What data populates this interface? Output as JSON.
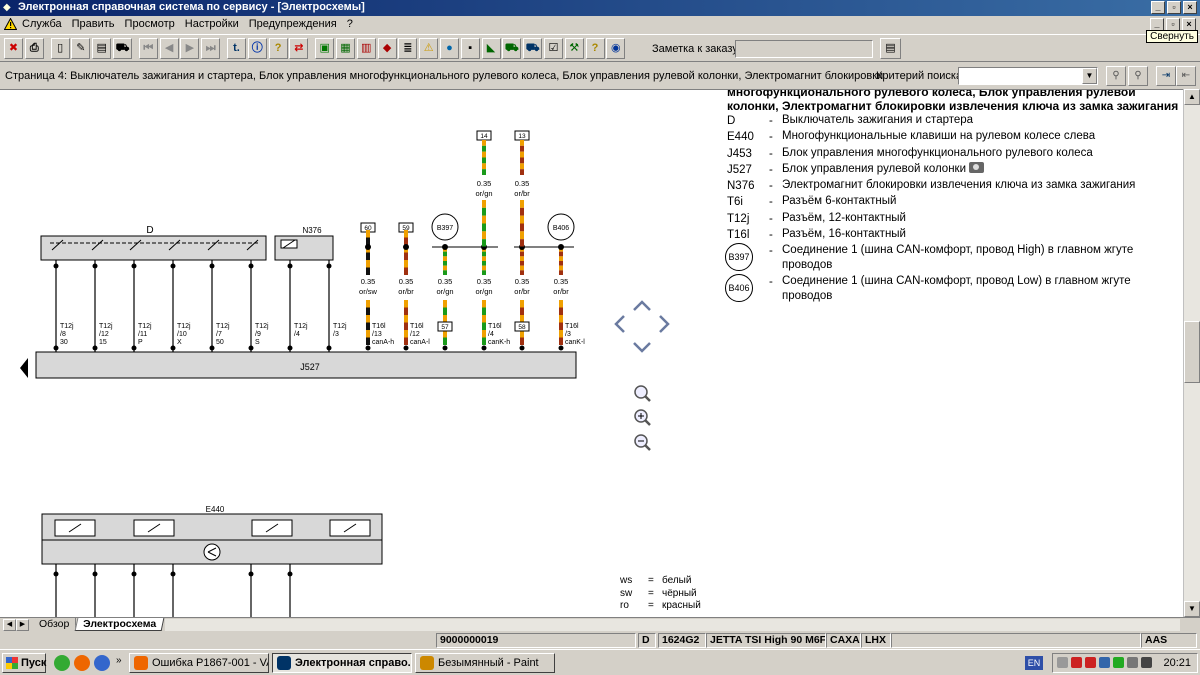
{
  "window": {
    "title": "Электронная справочная система по сервису - [Электросхемы]",
    "tooltip": "Свернуть"
  },
  "menu": {
    "items": [
      "Служба",
      "Править",
      "Просмотр",
      "Настройки",
      "Предупреждения",
      "?"
    ]
  },
  "toolbar": {
    "note_label": "Заметка к заказу:",
    "note_value": ""
  },
  "page": {
    "title": "Страница 4: Выключатель зажигания и стартера, Блок управления многофункционального рулевого колеса, Блок управления рулевой колонки, Электромагнит блокировки",
    "search_label": "Критерий поиска:",
    "search_value": ""
  },
  "diagram": {
    "labels": {
      "d": "D",
      "n376": "N376",
      "j527": "J527",
      "e440": "E440",
      "b397": "B397",
      "b406": "B406"
    },
    "bottom_pins": [
      {
        "conn": "T12j",
        "pin": "/8",
        "term": "30"
      },
      {
        "conn": "T12j",
        "pin": "/12",
        "term": "15"
      },
      {
        "conn": "T12j",
        "pin": "/11",
        "term": "P"
      },
      {
        "conn": "T12j",
        "pin": "/10",
        "term": "X"
      },
      {
        "conn": "T12j",
        "pin": "/7",
        "term": "50"
      },
      {
        "conn": "T12j",
        "pin": "/9",
        "term": "S"
      },
      {
        "conn": "T12j",
        "pin": "/4",
        "term": ""
      },
      {
        "conn": "T12j",
        "pin": "/3",
        "term": ""
      }
    ],
    "top_boxes": [
      "60",
      "59",
      "14",
      "13",
      "57",
      "58"
    ],
    "wires": [
      {
        "size": "0.35",
        "color": "or/sw",
        "conn": "T16l",
        "pin": "/13",
        "sig": "canA-h"
      },
      {
        "size": "0.35",
        "color": "or/br",
        "conn": "T16l",
        "pin": "/12",
        "sig": "canA-l"
      },
      {
        "size": "0.35",
        "color": "or/gn",
        "conn": "",
        "pin": "",
        "sig": ""
      },
      {
        "size": "0.35",
        "color": "or/gn",
        "conn": "T16l",
        "pin": "/4",
        "sig": "canK-h"
      },
      {
        "size": "0.35",
        "color": "or/br",
        "conn": "",
        "pin": "",
        "sig": ""
      },
      {
        "size": "0.35",
        "color": "or/br",
        "conn": "T16l",
        "pin": "/3",
        "sig": "canK-l"
      }
    ],
    "upper_wires": [
      {
        "size": "0.35",
        "color": "or/gn"
      },
      {
        "size": "0.35",
        "color": "or/br"
      }
    ]
  },
  "legend": {
    "heading": "многофункционального рулевого колеса, Блок управления рулевой колонки, Электромагнит блокировки извлечения ключа из замка зажигания",
    "rows": [
      {
        "code": "D",
        "desc": "Выключатель зажигания и стартера"
      },
      {
        "code": "E440",
        "desc": "Многофункциональные клавиши на рулевом колесе слева"
      },
      {
        "code": "J453",
        "desc": "Блок управления многофункционального рулевого колеса"
      },
      {
        "code": "J527",
        "desc": "Блок управления рулевой колонки"
      },
      {
        "code": "N376",
        "desc": "Электромагнит блокировки извлечения ключа из замка зажигания"
      },
      {
        "code": "T6i",
        "desc": "Разъём 6-контактный"
      },
      {
        "code": "T12j",
        "desc": "Разъём, 12-контактный"
      },
      {
        "code": "T16l",
        "desc": "Разъём, 16-контактный"
      },
      {
        "code": "B397",
        "desc": "Соединение 1 (шина CAN-комфорт, провод High) в главном жгуте проводов"
      },
      {
        "code": "B406",
        "desc": "Соединение 1 (шина CAN-комфорт, провод Low) в главном жгуте проводов"
      }
    ]
  },
  "colors": [
    {
      "code": "ws",
      "name": "белый"
    },
    {
      "code": "sw",
      "name": "чёрный"
    },
    {
      "code": "ro",
      "name": "красный"
    }
  ],
  "tabs": [
    "Обзор",
    "Электросхема"
  ],
  "status": {
    "order": "9000000019",
    "d": "D",
    "code": "1624G2",
    "model": "JETTA TSI High 90 M6F",
    "engine": "CAXA",
    "gear": "LHX",
    "last": "AAS"
  },
  "taskbar": {
    "start": "Пуск",
    "tasks": [
      "Ошибка P1867-001 - VA...",
      "Электронная справо...",
      "Безымянный - Paint"
    ],
    "lang": "EN",
    "clock": "20:21"
  }
}
